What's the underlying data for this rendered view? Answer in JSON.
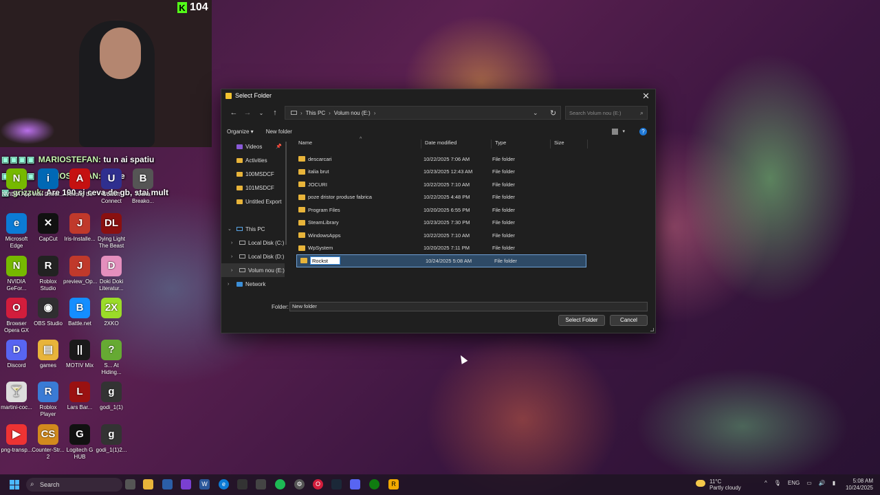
{
  "stream": {
    "viewer_count": "104",
    "chat": [
      {
        "user": "MARIOSTEFAN:",
        "text": "tu n ai spatiu"
      },
      {
        "user": "MARIOSTEFAN:",
        "text": "goale"
      },
      {
        "user": "grizzuk:",
        "text": "Are 100 si ceva de gb, stai mult"
      }
    ]
  },
  "desktop_icons": [
    {
      "label": "NVIDIA App",
      "glyph": "N",
      "color": "#76b900"
    },
    {
      "label": "Intel Driver...",
      "glyph": "i",
      "color": "#0068b5"
    },
    {
      "label": "Among Us",
      "glyph": "A",
      "color": "#c51111"
    },
    {
      "label": "Ubisoft Connect",
      "glyph": "U",
      "color": "#2f2f8f"
    },
    {
      "label": "Arena Breako...",
      "glyph": "B",
      "color": "#555"
    },
    {
      "label": "Microsoft Edge",
      "glyph": "e",
      "color": "#0c7bd5"
    },
    {
      "label": "CapCut",
      "glyph": "✕",
      "color": "#111"
    },
    {
      "label": "Iris-Installe...",
      "glyph": "J",
      "color": "#c0392b"
    },
    {
      "label": "Dying Light The Beast",
      "glyph": "DL",
      "color": "#8a1010"
    },
    {
      "label": "NVIDIA GeFor...",
      "glyph": "N",
      "color": "#76b900"
    },
    {
      "label": "Roblox Studio",
      "glyph": "R",
      "color": "#222"
    },
    {
      "label": "preview_Op...",
      "glyph": "J",
      "color": "#c0392b"
    },
    {
      "label": "Doki Doki Literatur...",
      "glyph": "D",
      "color": "#e48fbd"
    },
    {
      "label": "Browser Opera GX",
      "glyph": "O",
      "color": "#d21d3c"
    },
    {
      "label": "OBS Studio",
      "glyph": "◉",
      "color": "#302e31"
    },
    {
      "label": "Battle.net",
      "glyph": "B",
      "color": "#148eff"
    },
    {
      "label": "2XKO",
      "glyph": "2X",
      "color": "#9bdc28"
    },
    {
      "label": "Discord",
      "glyph": "D",
      "color": "#5865f2"
    },
    {
      "label": "games",
      "glyph": "▤",
      "color": "#e8b43a"
    },
    {
      "label": "MOTIV Mix",
      "glyph": "||",
      "color": "#1a1a1a"
    },
    {
      "label": "S... At Hiding...",
      "glyph": "?",
      "color": "#6a3"
    },
    {
      "label": "martini-coc...",
      "glyph": "🍸",
      "color": "#ddd"
    },
    {
      "label": "Roblox Player",
      "glyph": "R",
      "color": "#3a7bd5"
    },
    {
      "label": "Lars Bar...",
      "glyph": "L",
      "color": "#9a1111"
    },
    {
      "label": "godi_1(1)",
      "glyph": "g",
      "color": "#333"
    },
    {
      "label": "png-transp...",
      "glyph": "▶",
      "color": "#e33"
    },
    {
      "label": "Counter-Str... 2",
      "glyph": "CS",
      "color": "#d28a1d"
    },
    {
      "label": "Logitech G HUB",
      "glyph": "G",
      "color": "#111"
    },
    {
      "label": "godi_1(1)2...",
      "glyph": "g",
      "color": "#333"
    }
  ],
  "dialog": {
    "title": "Select Folder",
    "breadcrumb": [
      "This PC",
      "Volum nou (E:)"
    ],
    "search_placeholder": "Search Volum nou (E:)",
    "organize": "Organize ▾",
    "new_folder": "New folder",
    "nav": {
      "videos": "Videos",
      "activities": "Activities",
      "f100": "100MSDCF",
      "f101": "101MSDCF",
      "untitled": "Untitled Export",
      "this_pc": "This PC",
      "local_c": "Local Disk (C:)",
      "local_d": "Local Disk (D:)",
      "volum_e": "Volum nou (E:)",
      "network": "Network"
    },
    "columns": {
      "name": "Name",
      "date": "Date modified",
      "type": "Type",
      "size": "Size"
    },
    "rows": [
      {
        "name": "descarcari",
        "date": "10/22/2025 7:06 AM",
        "type": "File folder"
      },
      {
        "name": "italia brut",
        "date": "10/23/2025 12:43 AM",
        "type": "File folder"
      },
      {
        "name": "JOCURI",
        "date": "10/22/2025 7:10 AM",
        "type": "File folder"
      },
      {
        "name": "poze dristor produse fabrica",
        "date": "10/22/2025 4:48 PM",
        "type": "File folder"
      },
      {
        "name": "Program Files",
        "date": "10/20/2025 6:55 PM",
        "type": "File folder"
      },
      {
        "name": "SteamLibrary",
        "date": "10/23/2025 7:30 PM",
        "type": "File folder"
      },
      {
        "name": "WindowsApps",
        "date": "10/22/2025 7:10 AM",
        "type": "File folder"
      },
      {
        "name": "WpSystem",
        "date": "10/20/2025 7:11 PM",
        "type": "File folder"
      }
    ],
    "renaming_row": {
      "value": "Rockst",
      "date": "10/24/2025 5:08 AM",
      "type": "File folder"
    },
    "folder_label": "Folder:",
    "folder_value": "New folder",
    "select_button": "Select Folder",
    "cancel_button": "Cancel"
  },
  "taskbar": {
    "search_label": "Search",
    "weather_temp": "11°C",
    "weather_desc": "Partly cloudy",
    "language": "ENG",
    "time": "5:08 AM",
    "date": "10/24/2025"
  }
}
